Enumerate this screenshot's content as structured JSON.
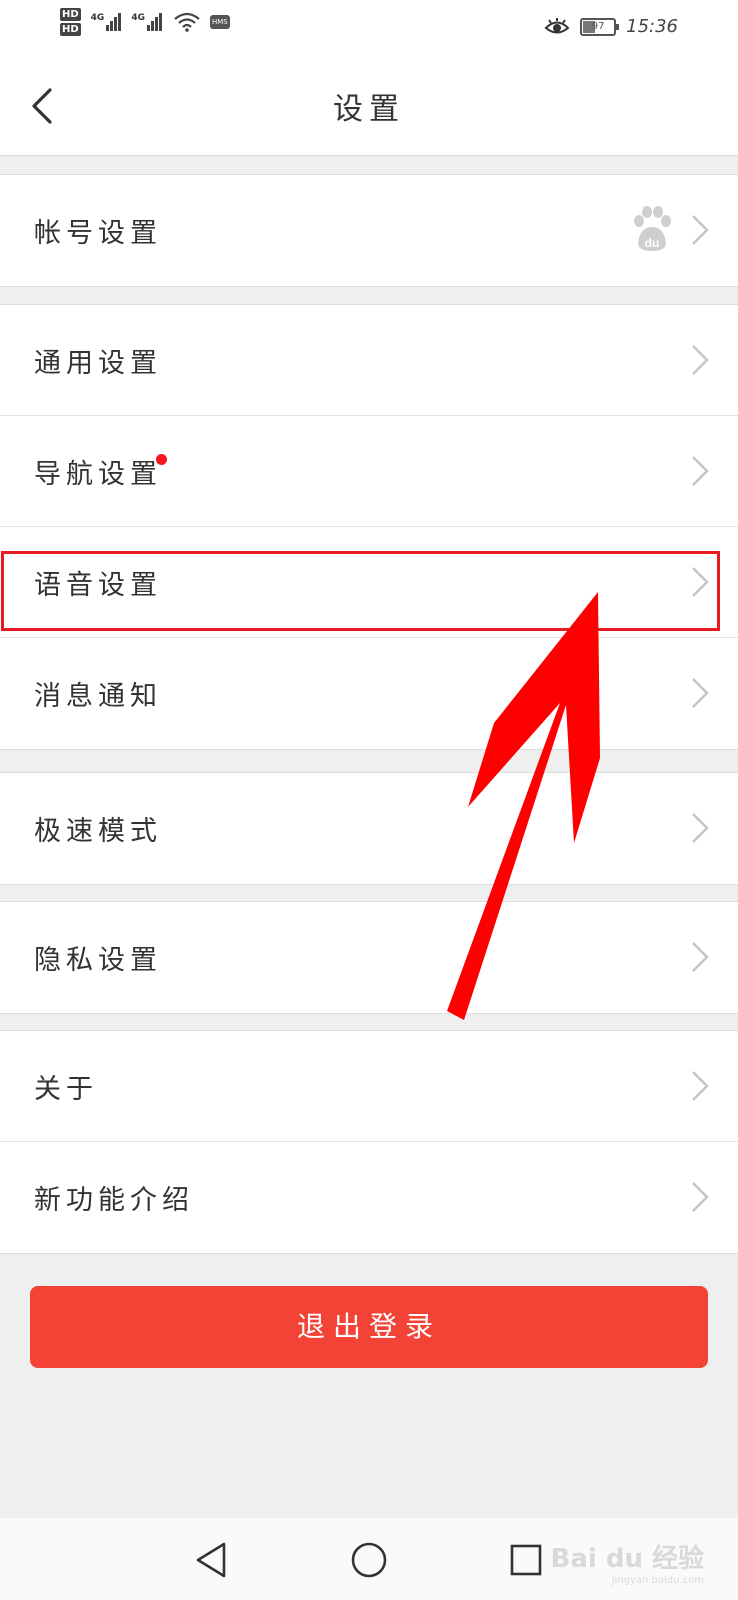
{
  "status_bar": {
    "sim1": "HD",
    "sim2": "HD",
    "net1": "4G",
    "net2": "4G",
    "hms": "HMS",
    "battery": "97",
    "time": "15:36"
  },
  "nav": {
    "title": "设置",
    "back_icon": "chevron-left-icon"
  },
  "groups": [
    {
      "items": [
        {
          "label": "帐号设置",
          "extra_icon": "baidu-paw-icon"
        }
      ]
    },
    {
      "items": [
        {
          "label": "通用设置"
        },
        {
          "label": "导航设置",
          "badge": "red-dot"
        },
        {
          "label": "语音设置",
          "highlighted": true
        },
        {
          "label": "消息通知"
        }
      ]
    },
    {
      "items": [
        {
          "label": "极速模式"
        }
      ]
    },
    {
      "items": [
        {
          "label": "隐私设置"
        }
      ]
    },
    {
      "items": [
        {
          "label": "关于"
        },
        {
          "label": "新功能介绍"
        }
      ]
    }
  ],
  "logout": {
    "label": "退出登录"
  },
  "system_nav": [
    "back-triangle-icon",
    "home-circle-icon",
    "recents-square-icon"
  ],
  "watermark": {
    "main": "Bai du 经验",
    "sub": "jingyan.baidu.com"
  },
  "colors": {
    "accent_red": "#f34336",
    "annotation_red": "#ff0000",
    "badge_red": "#f2181e",
    "background": "#efefef"
  }
}
